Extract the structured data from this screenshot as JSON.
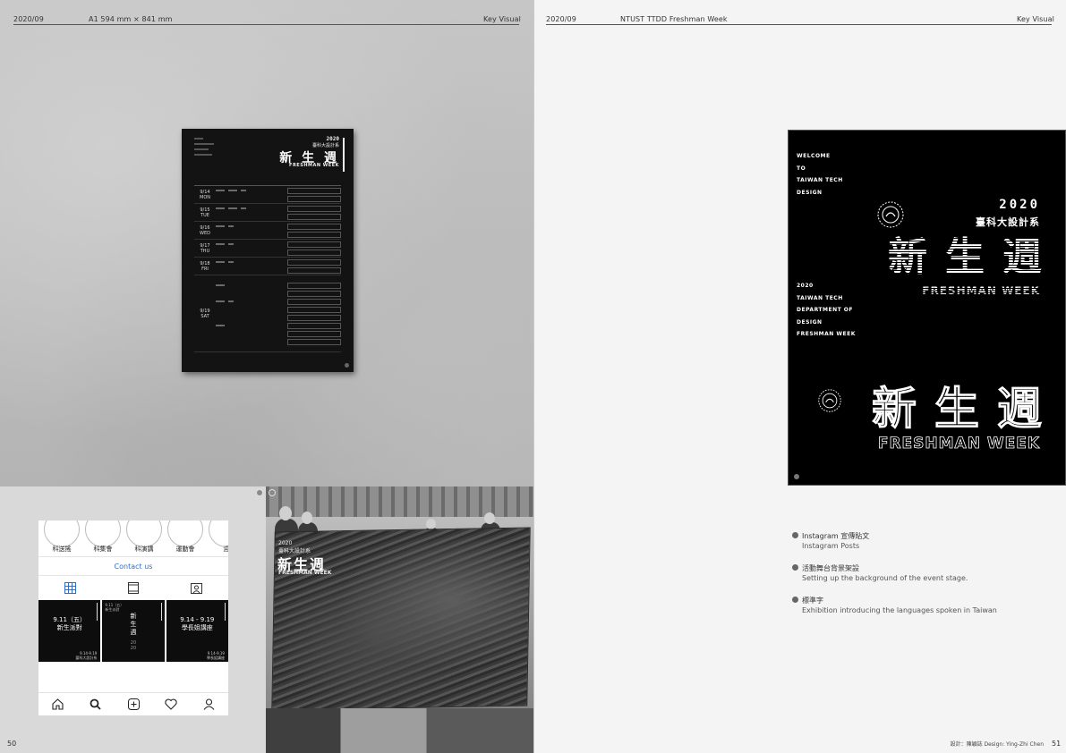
{
  "left_page": {
    "header": {
      "date": "2020/09",
      "size": "A1 594 mm × 841 mm",
      "section": "Key Visual"
    },
    "page_number": "50"
  },
  "right_page": {
    "header": {
      "date": "2020/09",
      "project": "NTUST TTDD Freshman Week",
      "section": "Key Visual"
    },
    "page_number": "51",
    "credit": "設計：陳穎誌    Design: Ying-Zhi Chen"
  },
  "poster": {
    "year": "2020",
    "dept": "臺科大設計系",
    "title": "新 生 週",
    "title_en": "FRESHMAN WEEK",
    "schedule": [
      {
        "day": "9/14",
        "dow": "MON"
      },
      {
        "day": "9/15",
        "dow": "TUE"
      },
      {
        "day": "9/16",
        "dow": "WED"
      },
      {
        "day": "9/17",
        "dow": "THU"
      },
      {
        "day": "9/18",
        "dow": "FRI"
      },
      {
        "day": "9/19",
        "dow": "SAT"
      }
    ]
  },
  "instagram": {
    "stories": [
      "科送搖",
      "科集會",
      "科演講",
      "運動會",
      "迎"
    ],
    "contact_label": "Contact us",
    "posts": [
      {
        "date": "9.11（五）",
        "title": "新生派對",
        "foot": "9.14-9.19\n臺科大設計系"
      },
      {
        "header": "9.11（五）\n新生派對",
        "title": "新\n生\n週",
        "sub": "20\n20"
      },
      {
        "date": "9.14 - 9.19",
        "title": "學長姐講座",
        "foot": "9.14-9.19\n學長姐講座"
      }
    ]
  },
  "stage_banner": {
    "year": "2020",
    "dept": "臺科大設計系",
    "title": "新生週",
    "title_en": "FRESHMAN WEEK"
  },
  "key_visual": {
    "welcome": [
      "WELCOME",
      "TO",
      "TAIWAN TECH",
      "DESIGN"
    ],
    "year": "2020",
    "dept": "臺科大設計系",
    "title": "新生週",
    "title_en": "FRESHMAN WEEK",
    "info": [
      "2020",
      "TAIWAN TECH",
      "DEPARTMENT OF",
      "DESIGN",
      "FRESHMAN WEEK"
    ]
  },
  "captions": [
    {
      "zh": "Instagram 宣傳貼文",
      "en": "Instagram Posts"
    },
    {
      "zh": "活動舞台背景架設",
      "en": "Setting up the background of the event stage."
    },
    {
      "zh": "標準字",
      "en": "Exhibition introducing the languages spoken in Taiwan"
    }
  ],
  "colors": {
    "accent_link": "#2d6fd0",
    "poster_bg": "#131313",
    "page_bg": "#f4f4f4"
  }
}
